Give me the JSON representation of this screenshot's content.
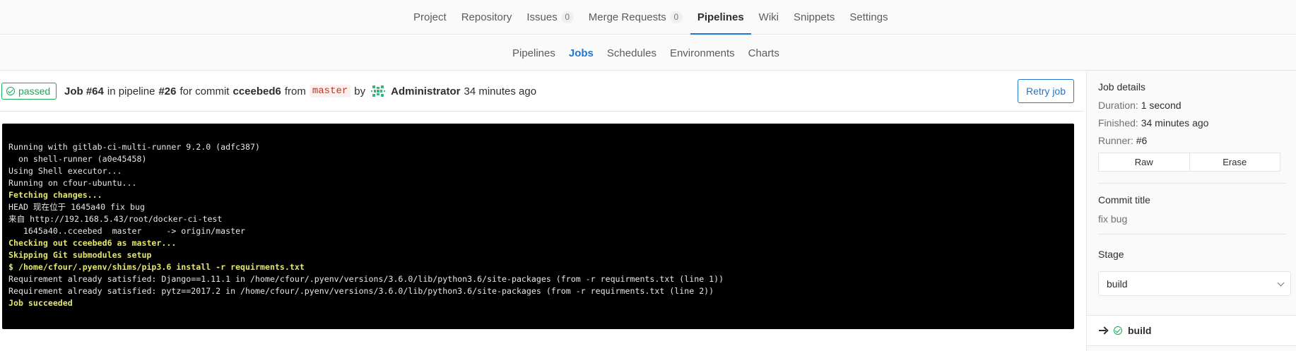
{
  "top_nav": {
    "tabs": [
      {
        "label": "Project"
      },
      {
        "label": "Repository"
      },
      {
        "label": "Issues",
        "count": "0"
      },
      {
        "label": "Merge Requests",
        "count": "0"
      },
      {
        "label": "Pipelines"
      },
      {
        "label": "Wiki"
      },
      {
        "label": "Snippets"
      },
      {
        "label": "Settings"
      }
    ],
    "active": "Pipelines"
  },
  "sub_nav": {
    "tabs": [
      {
        "label": "Pipelines"
      },
      {
        "label": "Jobs"
      },
      {
        "label": "Schedules"
      },
      {
        "label": "Environments"
      },
      {
        "label": "Charts"
      }
    ],
    "active": "Jobs"
  },
  "header": {
    "status": "passed",
    "job_label": "Job #64",
    "in_pipeline": "in pipeline",
    "pipeline": "#26",
    "for_commit": "for commit",
    "commit": "cceebed6",
    "from": "from",
    "branch": "master",
    "by": "by",
    "user": "Administrator",
    "time": "34 minutes ago",
    "retry_label": "Retry job"
  },
  "trace": [
    {
      "text": "Running with gitlab-ci-multi-runner 9.2.0 (adfc387)",
      "hl": false
    },
    {
      "text": "  on shell-runner (a0e45458)",
      "hl": false
    },
    {
      "text": "Using Shell executor...",
      "hl": false
    },
    {
      "text": "Running on cfour-ubuntu...",
      "hl": false
    },
    {
      "text": "Fetching changes...",
      "hl": true
    },
    {
      "text": "HEAD 现在位于 1645a40 fix bug",
      "hl": false
    },
    {
      "text": "来自 http://192.168.5.43/root/docker-ci-test",
      "hl": false
    },
    {
      "text": "   1645a40..cceebed  master     -> origin/master",
      "hl": false
    },
    {
      "text": "Checking out cceebed6 as master...",
      "hl": true
    },
    {
      "text": "Skipping Git submodules setup",
      "hl": true
    },
    {
      "text": "$ /home/cfour/.pyenv/shims/pip3.6 install -r requirments.txt",
      "hl": true
    },
    {
      "text": "Requirement already satisfied: Django==1.11.1 in /home/cfour/.pyenv/versions/3.6.0/lib/python3.6/site-packages (from -r requirments.txt (line 1))",
      "hl": false
    },
    {
      "text": "Requirement already satisfied: pytz==2017.2 in /home/cfour/.pyenv/versions/3.6.0/lib/python3.6/site-packages (from -r requirments.txt (line 2))",
      "hl": false
    },
    {
      "text": "Job succeeded",
      "hl": true
    }
  ],
  "sidebar": {
    "title": "Job details",
    "duration_label": "Duration:",
    "duration": "1 second",
    "finished_label": "Finished:",
    "finished": "34 minutes ago",
    "runner_label": "Runner:",
    "runner": "#6",
    "raw_label": "Raw",
    "erase_label": "Erase",
    "commit_title_label": "Commit title",
    "commit_title": "fix bug",
    "stage_label": "Stage",
    "stage_value": "build",
    "job_name": "build"
  },
  "colors": {
    "success": "#1aaa55",
    "link": "#1f78d1",
    "trace_bg": "#000000",
    "trace_highlight": "#e5e56f"
  }
}
